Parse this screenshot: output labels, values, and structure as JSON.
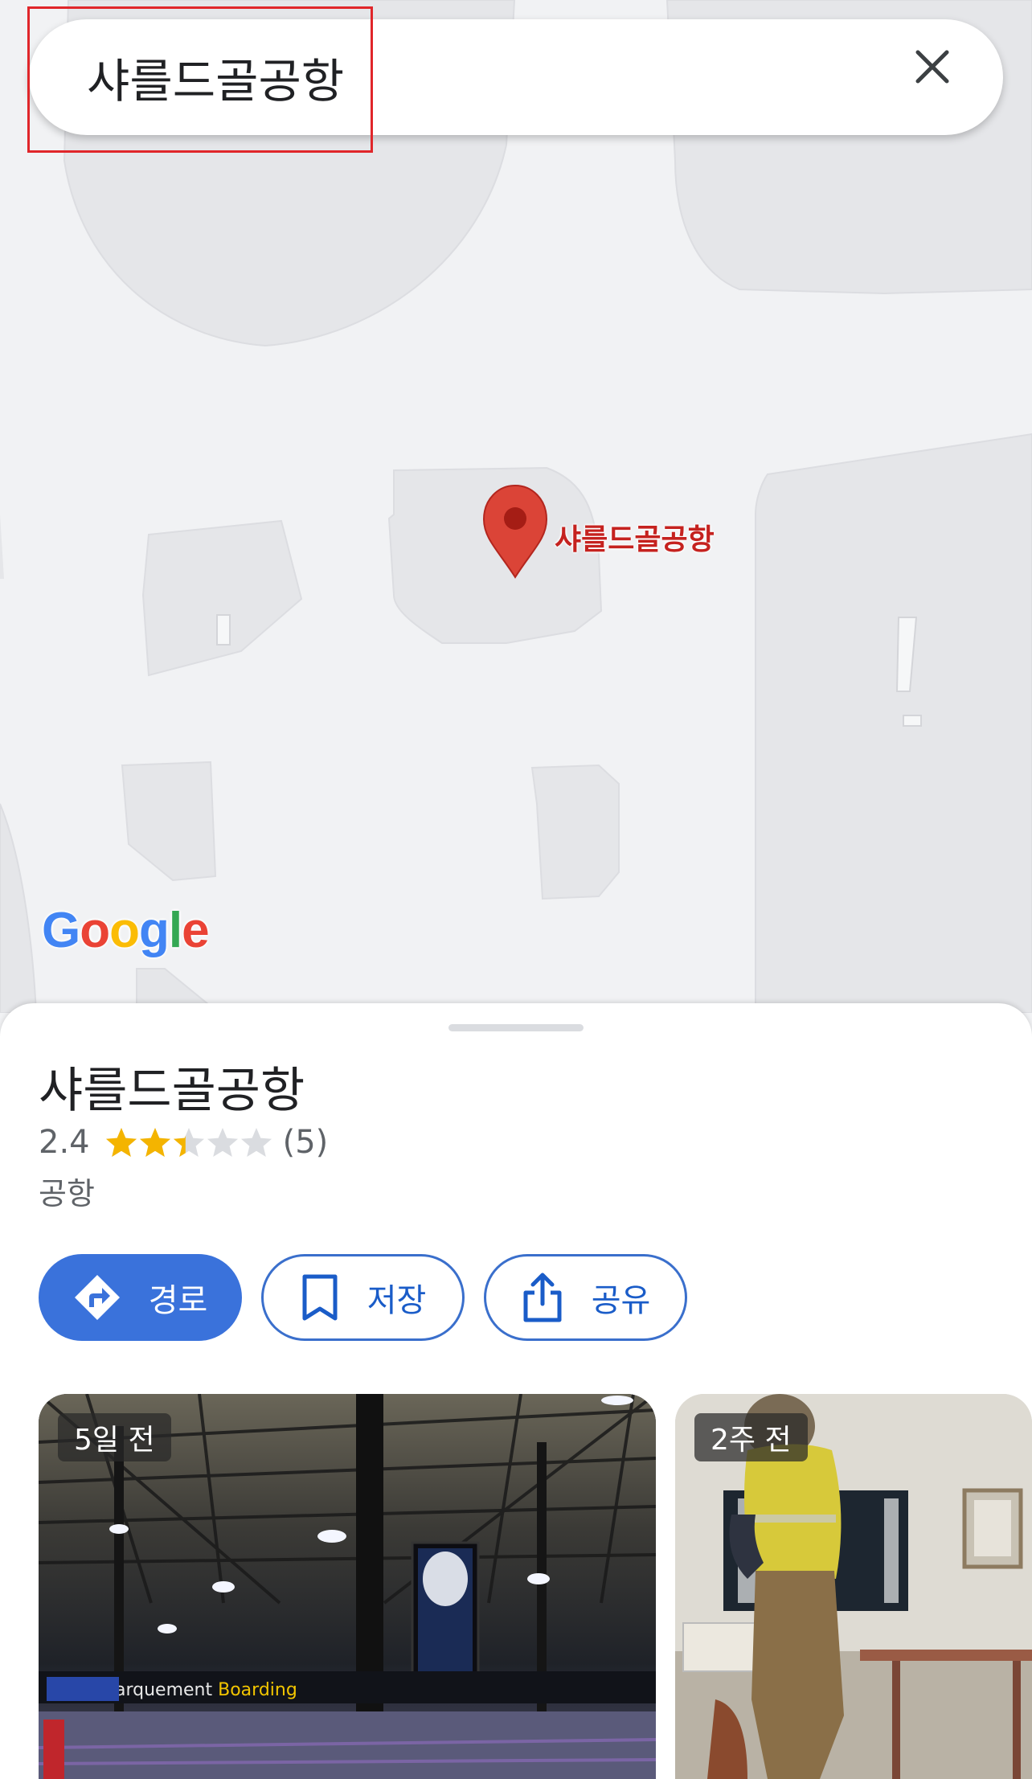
{
  "search": {
    "query": "샤를드골공항",
    "clear_icon": "close-icon"
  },
  "map": {
    "pin_label": "샤를드골공항",
    "pin_icon": "location-pin-icon",
    "logo_text": "Google",
    "logo_colors": [
      "#4285F4",
      "#EA4335",
      "#FBBC05",
      "#4285F4",
      "#34A853",
      "#EA4335"
    ]
  },
  "place": {
    "name": "샤를드골공항",
    "rating": "2.4",
    "rating_value": 2.4,
    "rating_max": 5,
    "review_count": "(5)",
    "category": "공항"
  },
  "actions": [
    {
      "label": "경로",
      "icon": "directions-icon"
    },
    {
      "label": "저장",
      "icon": "bookmark-icon"
    },
    {
      "label": "공유",
      "icon": "share-icon"
    }
  ],
  "photos": [
    {
      "badge": "5일 전",
      "sign_text": "arquement Boarding"
    },
    {
      "badge": "2주 전"
    }
  ],
  "colors": {
    "accent": "#3a72db",
    "pin_red": "#db4437",
    "star_gold": "#f4b400",
    "star_empty": "#dadce0"
  }
}
